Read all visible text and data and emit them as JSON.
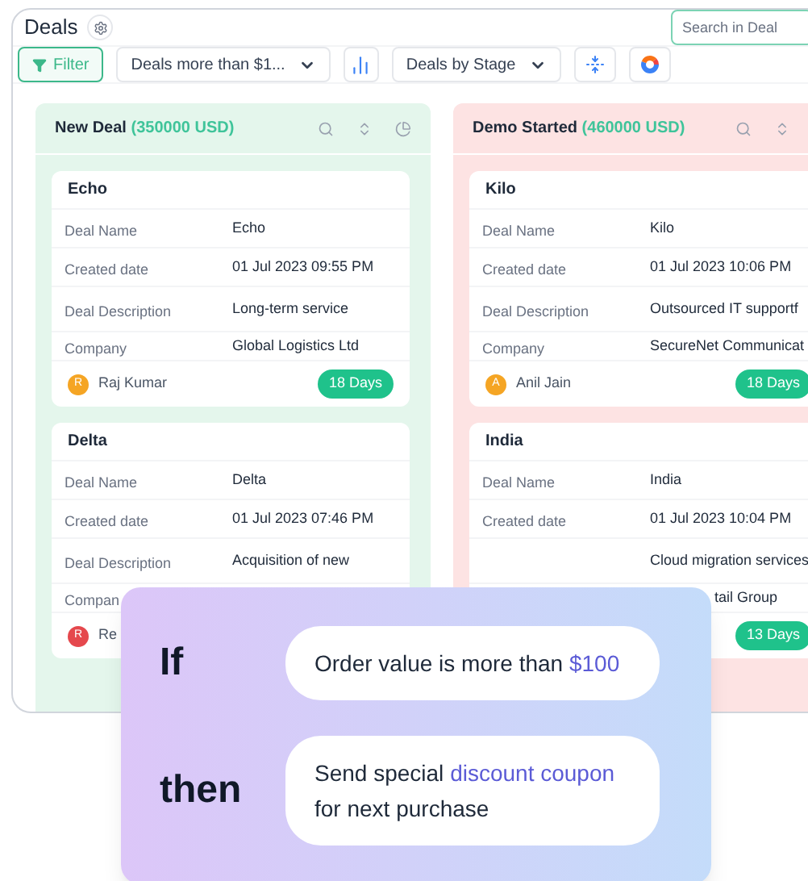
{
  "header": {
    "title": "Deals",
    "search": {
      "placeholder": "Search in Deal"
    }
  },
  "toolbar": [
    {
      "kind": "filter",
      "label": "Filter",
      "selected": true
    },
    {
      "kind": "dropdown",
      "label": "Deals more than $1..."
    },
    {
      "kind": "bars"
    },
    {
      "kind": "dropdown",
      "label": "Deals by Stage"
    },
    {
      "kind": "compress"
    },
    {
      "kind": "pie"
    }
  ],
  "columns": [
    {
      "name": "New Deal",
      "total": "(350000 USD)",
      "color": "#e4f6ec",
      "deals": [
        {
          "title": "Echo",
          "fields": [
            {
              "label": "Deal Name",
              "value": "Echo"
            },
            {
              "label": "Created date",
              "value": "01 Jul 2023 09:55 PM"
            },
            {
              "label": "Deal Description",
              "value": "Long-term service"
            },
            {
              "label": "Company",
              "value": "Global Logistics Ltd"
            }
          ],
          "owner_initial": "R",
          "owner": "Raj Kumar",
          "color": "#f5a524",
          "days": "18 Days"
        },
        {
          "title": "Delta",
          "fields": [
            {
              "label": "Deal Name",
              "value": "Delta"
            },
            {
              "label": "Created date",
              "value": "01 Jul 2023 07:46 PM"
            },
            {
              "label": "Deal Description",
              "value": "Acquisition of new"
            },
            {
              "label": "Compan"
            }
          ],
          "owner_initial": "R",
          "owner": "Re",
          "color": "#e5484d"
        }
      ]
    },
    {
      "name": "Demo Started",
      "total": "(460000 USD)",
      "color": "#fde3e3",
      "deals": [
        {
          "title": "Kilo",
          "fields": [
            {
              "label": "Deal Name",
              "value": "Kilo"
            },
            {
              "label": "Created date",
              "value": "01 Jul 2023 10:06 PM"
            },
            {
              "label": "Deal Description",
              "value": "Outsourced IT supportf"
            },
            {
              "label": "Company",
              "value": "SecureNet Communicat"
            }
          ],
          "owner_initial": "A",
          "owner": "Anil Jain",
          "color": "#f5a524",
          "days": "18 Days"
        },
        {
          "title": "India",
          "fields": [
            {
              "label": "Deal Name",
              "value": "India"
            },
            {
              "label": "Created date",
              "value": "01 Jul 2023 10:04 PM"
            },
            {
              "value": "Cloud migration services"
            },
            {
              "value": "tail Group",
              "kind": "partial"
            }
          ],
          "days": "13 Days"
        }
      ]
    }
  ],
  "rule": [
    {
      "keyword": "If",
      "parts": [
        {
          "text": "Order value is more than ",
          "highlighted": false
        },
        {
          "text": "$100",
          "highlighted": true
        }
      ]
    },
    {
      "keyword": "then",
      "parts": [
        {
          "text": "Send special ",
          "highlighted": false
        },
        {
          "text": "discount coupon",
          "highlighted": true
        },
        {
          "text": " for next purchase",
          "highlighted": false
        }
      ]
    }
  ]
}
